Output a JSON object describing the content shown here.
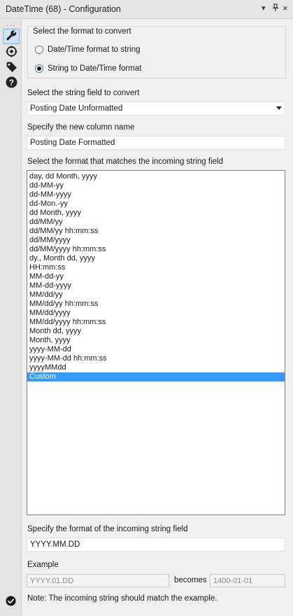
{
  "window": {
    "title": "DateTime (68) - Configuration",
    "dropdown_glyph": "▾",
    "pin_glyph": "⊥",
    "close_glyph": "×"
  },
  "toolrail": {
    "grip": "···",
    "icons": [
      "wrench-icon",
      "target-icon",
      "tag-icon",
      "help-icon"
    ]
  },
  "conversion": {
    "group_title": "Select the format to convert",
    "options": [
      {
        "label": "Date/Time format to string",
        "checked": false
      },
      {
        "label": "String to Date/Time format",
        "checked": true
      }
    ]
  },
  "string_field": {
    "label": "Select the string field to convert",
    "value": "Posting Date Unformatted"
  },
  "new_column": {
    "label": "Specify the new column name",
    "value": "Posting Date Formatted"
  },
  "format_list": {
    "label": "Select the format that matches the incoming string field",
    "items": [
      "day, dd Month, yyyy",
      "dd-MM-yy",
      "dd-MM-yyyy",
      "dd-Mon.-yy",
      "dd Month, yyyy",
      "dd/MM/yy",
      "dd/MM/yy hh:mm:ss",
      "dd/MM/yyyy",
      "dd/MM/yyyy hh:mm:ss",
      "dy., Month dd, yyyy",
      "HH:mm:ss",
      "MM-dd-yy",
      "MM-dd-yyyy",
      "MM/dd/yy",
      "MM/dd/yy hh:mm:ss",
      "MM/dd/yyyy",
      "MM/dd/yyyy hh:mm:ss",
      "Month dd, yyyy",
      "Month, yyyy",
      "yyyy-MM-dd",
      "yyyy-MM-dd hh:mm:ss",
      "yyyyMMdd",
      "Custom"
    ],
    "selected": "Custom"
  },
  "custom_format": {
    "label": "Specify the format of the incoming string field",
    "value": "YYYY.MM.DD"
  },
  "example": {
    "label": "Example",
    "input": "YYYY.01.DD",
    "becomes_label": "becomes",
    "output": "1400-01-01"
  },
  "note": "Note: The incoming string should match the example.",
  "colors": {
    "selection": "#3399ff",
    "status_icon": "#1a1a1a"
  }
}
